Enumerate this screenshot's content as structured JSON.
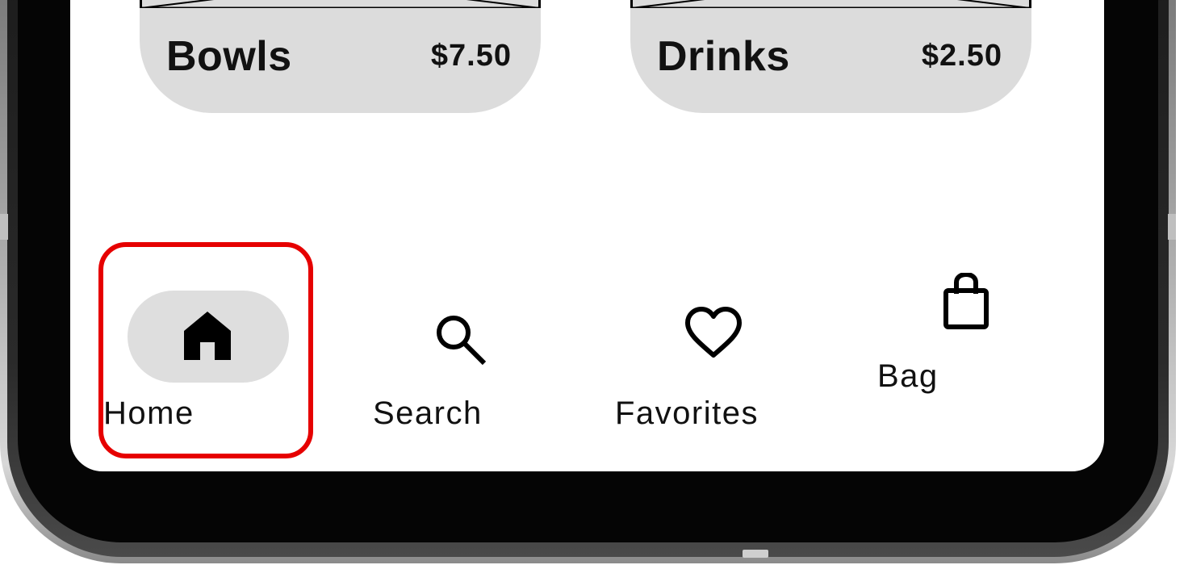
{
  "menu_cards": [
    {
      "name": "Bowls",
      "price": "$7.50"
    },
    {
      "name": "Drinks",
      "price": "$2.50"
    }
  ],
  "bottom_nav": {
    "items": [
      {
        "label": "Home",
        "icon": "home-icon",
        "selected": true
      },
      {
        "label": "Search",
        "icon": "search-icon",
        "selected": false
      },
      {
        "label": "Favorites",
        "icon": "heart-icon",
        "selected": false
      },
      {
        "label": "Bag",
        "icon": "shopping-bag-icon",
        "selected": false
      }
    ]
  },
  "colors": {
    "card_background": "#dcdcdc",
    "selected_pill": "#dedede",
    "highlight": "#e60000",
    "text": "#111111"
  }
}
